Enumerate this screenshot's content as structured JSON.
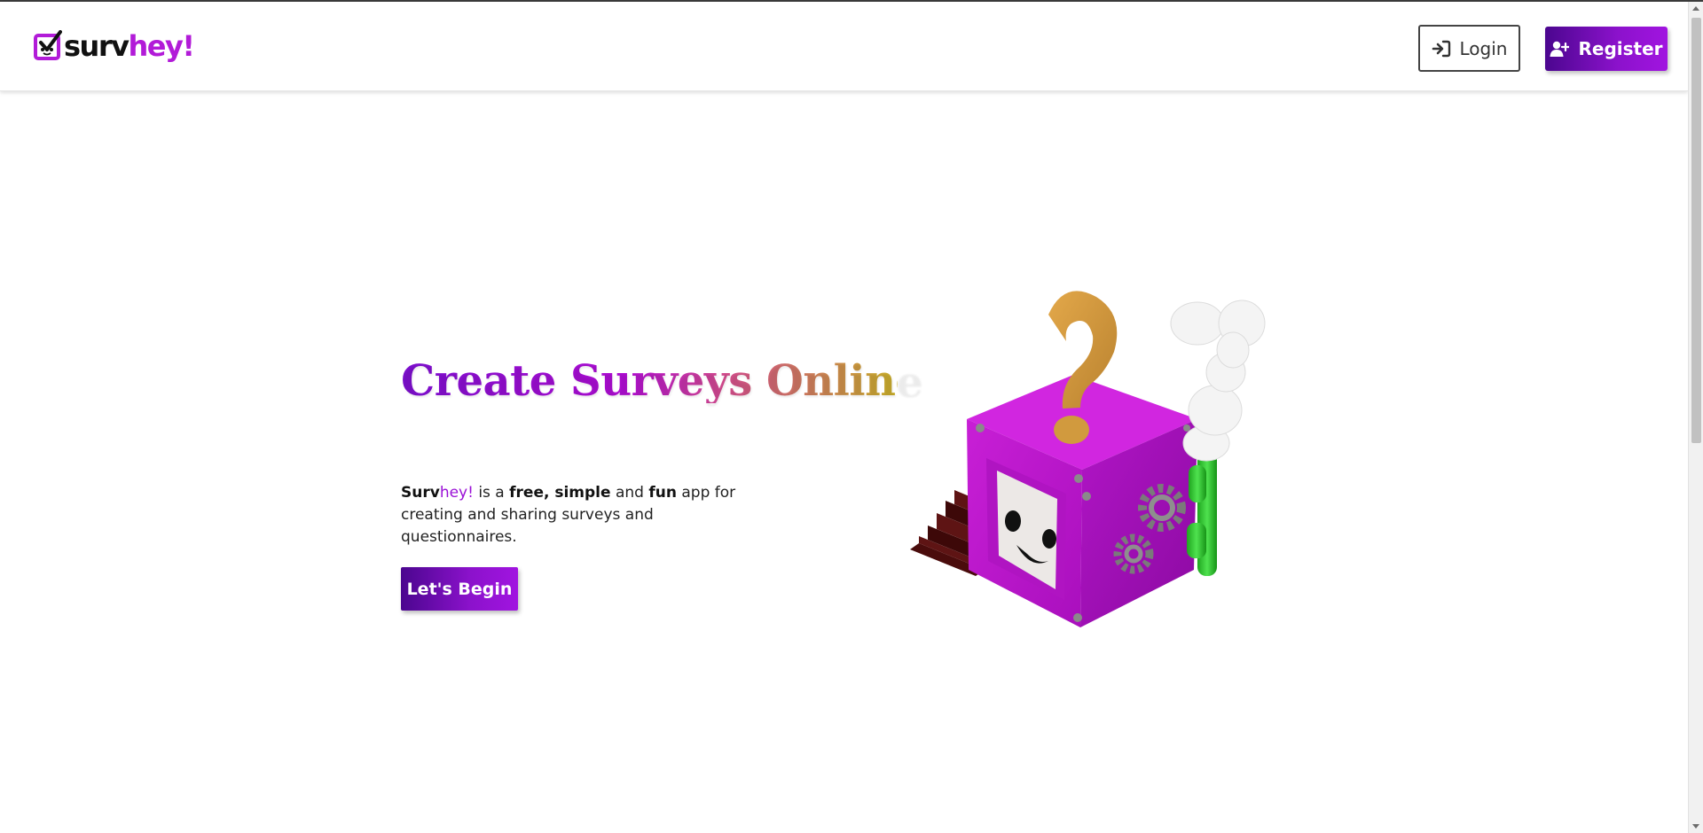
{
  "header": {
    "logo": {
      "part1": "surv",
      "part2": "hey!",
      "icon": "checkbox-face-icon"
    },
    "login_label": "Login",
    "register_label": "Register",
    "login_icon": "sign-in-icon",
    "register_icon": "user-plus-icon"
  },
  "hero": {
    "title": "Create Surveys Online",
    "description": {
      "brand_a": "Surv",
      "brand_b": "hey!",
      "t1": " is a ",
      "b1": "free, simple",
      "t2": " and ",
      "b2": "fun",
      "t3": " app for creating and sharing surveys and questionnaires."
    },
    "cta_label": "Let's Begin",
    "illustration": "purple-survey-box-mascot-illustration"
  },
  "colors": {
    "brand_purple": "#9a10d6",
    "button_gradient_start": "#4b068f",
    "button_gradient_end": "#a114e0"
  }
}
